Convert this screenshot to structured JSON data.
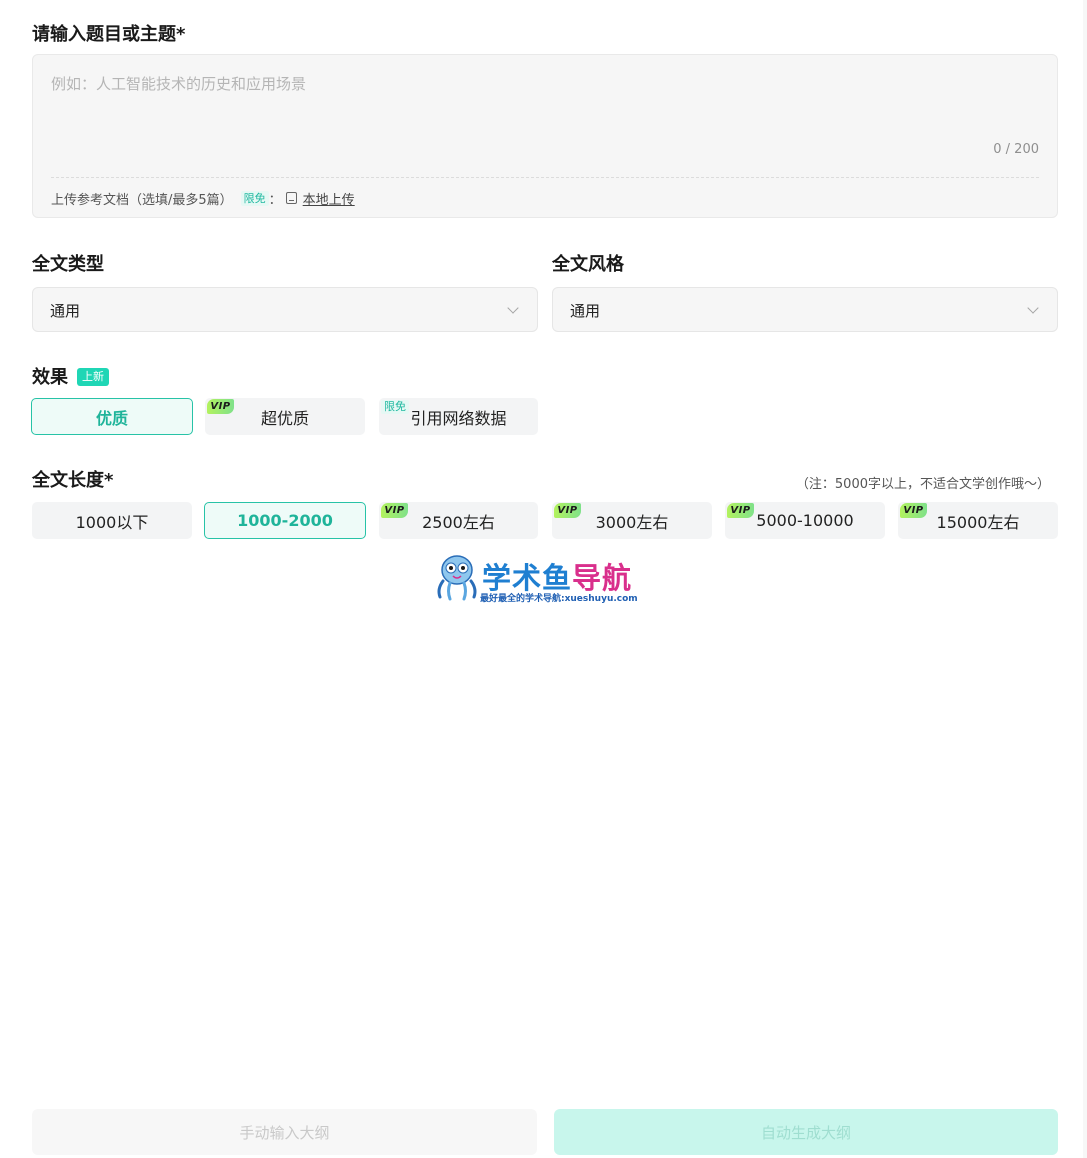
{
  "topic": {
    "label": "请输入题目或主题*",
    "placeholder": "例如：人工智能技术的历史和应用场景",
    "counter": "0 / 200",
    "upload_text": "上传参考文档（选填/最多5篇）",
    "upload_tag": "限免",
    "upload_colon": "：",
    "upload_link": "本地上传"
  },
  "type_field": {
    "label": "全文类型",
    "value": "通用"
  },
  "style_field": {
    "label": "全文风格",
    "value": "通用"
  },
  "effect": {
    "label": "效果",
    "badge": "上新",
    "options": [
      {
        "label": "优质",
        "selected": true
      },
      {
        "label": "超优质",
        "vip": "VIP"
      },
      {
        "label": "引用网络数据",
        "tag": "限免"
      }
    ]
  },
  "length": {
    "label": "全文长度*",
    "note": "（注：5000字以上，不适合文学创作哦～）",
    "options": [
      {
        "label": "1000以下"
      },
      {
        "label": "1000-2000",
        "selected": true
      },
      {
        "label": "2500左右",
        "vip": "VIP"
      },
      {
        "label": "3000左右",
        "vip": "VIP"
      },
      {
        "label": "5000-10000",
        "vip": "VIP"
      },
      {
        "label": "15000左右",
        "vip": "VIP"
      }
    ]
  },
  "logo": {
    "title_main": "学术鱼",
    "title_accent": "导航",
    "subtitle": "最好最全的学术导航:xueshuyu.com"
  },
  "buttons": {
    "manual": "手动输入大纲",
    "auto": "自动生成大纲"
  },
  "colors": {
    "accent": "#27c3a7",
    "vip_gradient_start": "#b3f25e",
    "auto_button_bg": "#c8f6ec"
  }
}
